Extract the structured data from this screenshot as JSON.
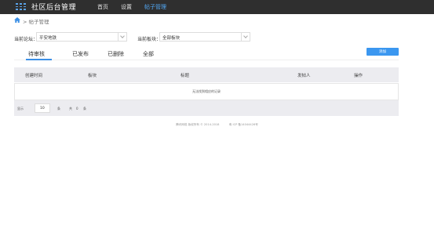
{
  "app": {
    "title": "社区后台管理"
  },
  "nav": {
    "items": [
      {
        "label": "首页"
      },
      {
        "label": "设置"
      },
      {
        "label": "帖子管理"
      }
    ]
  },
  "breadcrumb": {
    "text": "> 帖子管理"
  },
  "filters": {
    "forum_label": "当前论坛：",
    "forum_value": "平安地铁",
    "board_label": "当前板块：",
    "board_value": "全部板块"
  },
  "tabs": [
    {
      "label": "待审核"
    },
    {
      "label": "已发布"
    },
    {
      "label": "已删除"
    },
    {
      "label": "全部"
    }
  ],
  "toolbar": {
    "add_label": "添加"
  },
  "table": {
    "columns": [
      "创建时间",
      "板块",
      "标题",
      "发帖人",
      "操作"
    ],
    "empty_text": "无法找到相应的记录"
  },
  "pagination": {
    "show_label": "显示",
    "page_size": "10",
    "unit_label": "条",
    "total_label": "共",
    "total_count": "0",
    "total_unit": "条"
  },
  "footer": {
    "copyright": "腾讯网络 版权所有 © 2014-2018",
    "icp": "粤 ICP 备14044426号"
  },
  "colors": {
    "accent": "#3b97f0",
    "topbar": "#2f2f2f",
    "nav_active": "#52a8f5",
    "table_header": "#ececf0"
  }
}
